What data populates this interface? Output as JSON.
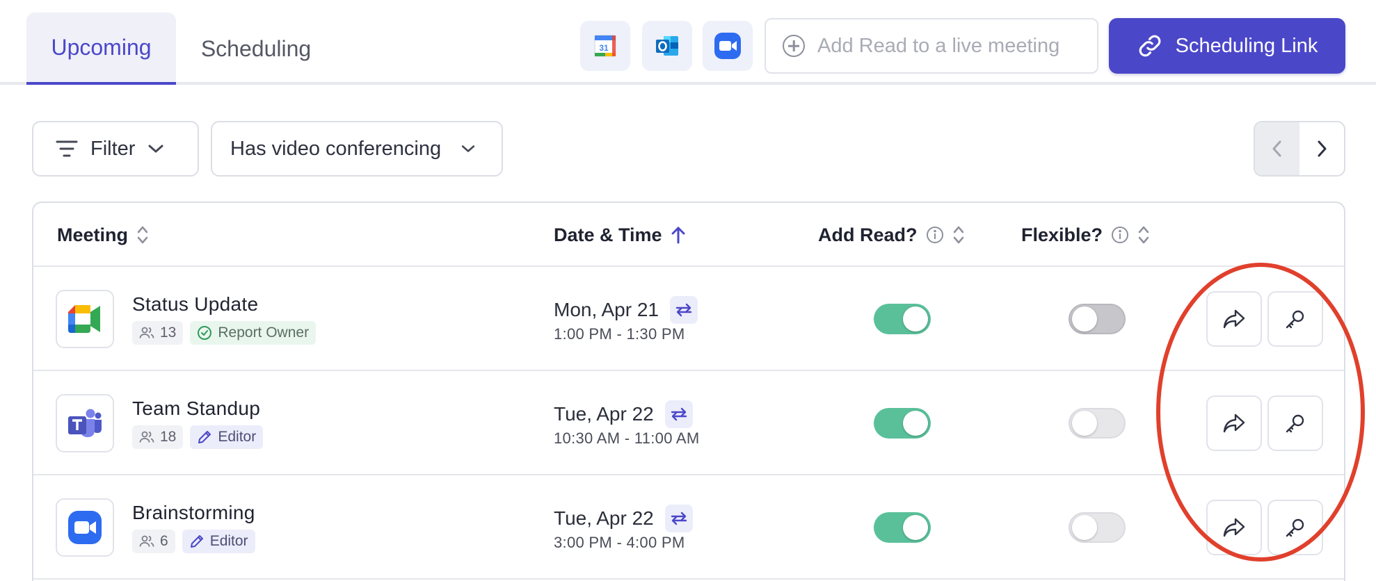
{
  "tabs": [
    {
      "label": "Upcoming",
      "active": true
    },
    {
      "label": "Scheduling",
      "active": false
    }
  ],
  "integrations": [
    {
      "icon": "google-calendar-icon"
    },
    {
      "icon": "outlook-icon"
    },
    {
      "icon": "zoom-icon"
    }
  ],
  "live_meeting": {
    "placeholder": "Add Read to a live meeting"
  },
  "scheduling_link": {
    "label": "Scheduling Link",
    "color": "#4b47c9"
  },
  "toolbar": {
    "filter_label": "Filter",
    "video_filter_label": "Has video conferencing"
  },
  "table": {
    "columns": {
      "meeting": "Meeting",
      "datetime": "Date & Time",
      "add_read": "Add Read?",
      "flexible": "Flexible?"
    },
    "sort": {
      "column": "datetime",
      "direction": "ascending"
    },
    "rows": [
      {
        "title": "Status Update",
        "app": "google-meet-icon",
        "participants": "13",
        "badge": "Report Owner",
        "badge_type": "owner",
        "date": "Mon, Apr 21",
        "time": "1:00 PM - 1:30 PM",
        "recurring": true,
        "add_read": true,
        "flexible": false
      },
      {
        "title": "Team Standup",
        "app": "microsoft-teams-icon",
        "participants": "18",
        "badge": "Editor",
        "badge_type": "editor",
        "date": "Tue, Apr 22",
        "time": "10:30 AM - 11:00 AM",
        "recurring": true,
        "add_read": true,
        "flexible": false
      },
      {
        "title": "Brainstorming",
        "app": "zoom-icon",
        "participants": "6",
        "badge": "Editor",
        "badge_type": "editor",
        "date": "Tue, Apr 22",
        "time": "3:00 PM - 4:00 PM",
        "recurring": true,
        "add_read": true,
        "flexible": false
      }
    ]
  },
  "colors": {
    "accent": "#4b47c9",
    "toggle_on": "#5ac09a",
    "annotation": "#e0402c"
  }
}
